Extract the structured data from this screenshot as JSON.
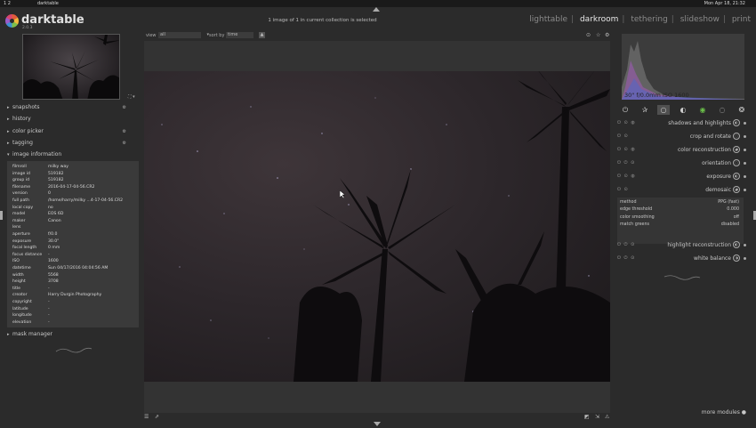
{
  "system_bar": {
    "workspaces": "1 2",
    "app_name": "darktable",
    "clock": "Mon Apr 18, 21:32"
  },
  "header": {
    "logo_name": "darktable",
    "version": "2.0.3",
    "selection_info": "1 image of 1 in current collection is selected",
    "views": [
      {
        "label": "lighttable",
        "active": false
      },
      {
        "label": "darkroom",
        "active": true
      },
      {
        "label": "tethering",
        "active": false
      },
      {
        "label": "slideshow",
        "active": false
      },
      {
        "label": "print",
        "active": false
      }
    ]
  },
  "filter_bar": {
    "view_label": "view",
    "view_value": "all",
    "sort_label": "sort by",
    "sort_value": "time"
  },
  "left_panel": {
    "sections": [
      {
        "label": "snapshots",
        "expanded": false
      },
      {
        "label": "history",
        "expanded": false
      },
      {
        "label": "color picker",
        "expanded": false
      },
      {
        "label": "tagging",
        "expanded": false
      },
      {
        "label": "image information",
        "expanded": true
      }
    ],
    "image_info": [
      {
        "key": "filmroll",
        "value": "milky way"
      },
      {
        "key": "image id",
        "value": "519182"
      },
      {
        "key": "group id",
        "value": "519182"
      },
      {
        "key": "filename",
        "value": "2016-04-17-04-56.CR2"
      },
      {
        "key": "version",
        "value": "0"
      },
      {
        "key": "full path",
        "value": "/home/harry/milky ...4-17-04-56.CR2"
      },
      {
        "key": "local copy",
        "value": "no"
      },
      {
        "key": "model",
        "value": "EOS 6D"
      },
      {
        "key": "maker",
        "value": "Canon"
      },
      {
        "key": "lens",
        "value": ""
      },
      {
        "key": "aperture",
        "value": "f/0.0"
      },
      {
        "key": "exposure",
        "value": "30.0\""
      },
      {
        "key": "focal length",
        "value": "0 mm"
      },
      {
        "key": "focus distance",
        "value": "-"
      },
      {
        "key": "ISO",
        "value": "1600"
      },
      {
        "key": "datetime",
        "value": "Sun 04/17/2016 04:04:56 AM"
      },
      {
        "key": "width",
        "value": "5568"
      },
      {
        "key": "height",
        "value": "3708"
      },
      {
        "key": "title",
        "value": "-"
      },
      {
        "key": "creator",
        "value": "Harry Durgin Photography"
      },
      {
        "key": "copyright",
        "value": "-"
      },
      {
        "key": "latitude",
        "value": "-"
      },
      {
        "key": "longitude",
        "value": "-"
      },
      {
        "key": "elevation",
        "value": "-"
      }
    ],
    "mask_manager": "mask manager"
  },
  "right_panel": {
    "histogram_text": "30\" f/0.0mm  ISO 1600",
    "module_groups": [
      "power-icon",
      "star-icon",
      "circle-icon",
      "contrast-icon",
      "color-icon",
      "correct-icon",
      "effect-icon"
    ],
    "modules_top": [
      {
        "name": "shadows and highlights"
      },
      {
        "name": "crop and rotate"
      },
      {
        "name": "color reconstruction"
      },
      {
        "name": "orientation"
      },
      {
        "name": "exposure"
      },
      {
        "name": "demosaic"
      }
    ],
    "demosaic_params": [
      {
        "key": "method",
        "value": "PPG (fast)"
      },
      {
        "key": "edge threshold",
        "value": "0.000"
      },
      {
        "key": "color smoothing",
        "value": "off"
      },
      {
        "key": "match greens",
        "value": "disabled"
      }
    ],
    "modules_bottom": [
      {
        "name": "highlight reconstruction"
      },
      {
        "name": "white balance"
      }
    ],
    "more_modules": "more modules"
  },
  "colors": {
    "background": "#2b2b2b",
    "panel_box": "#3a3a3a",
    "active_view": "#e8e8e8",
    "inactive_view": "#8a8a8a"
  }
}
